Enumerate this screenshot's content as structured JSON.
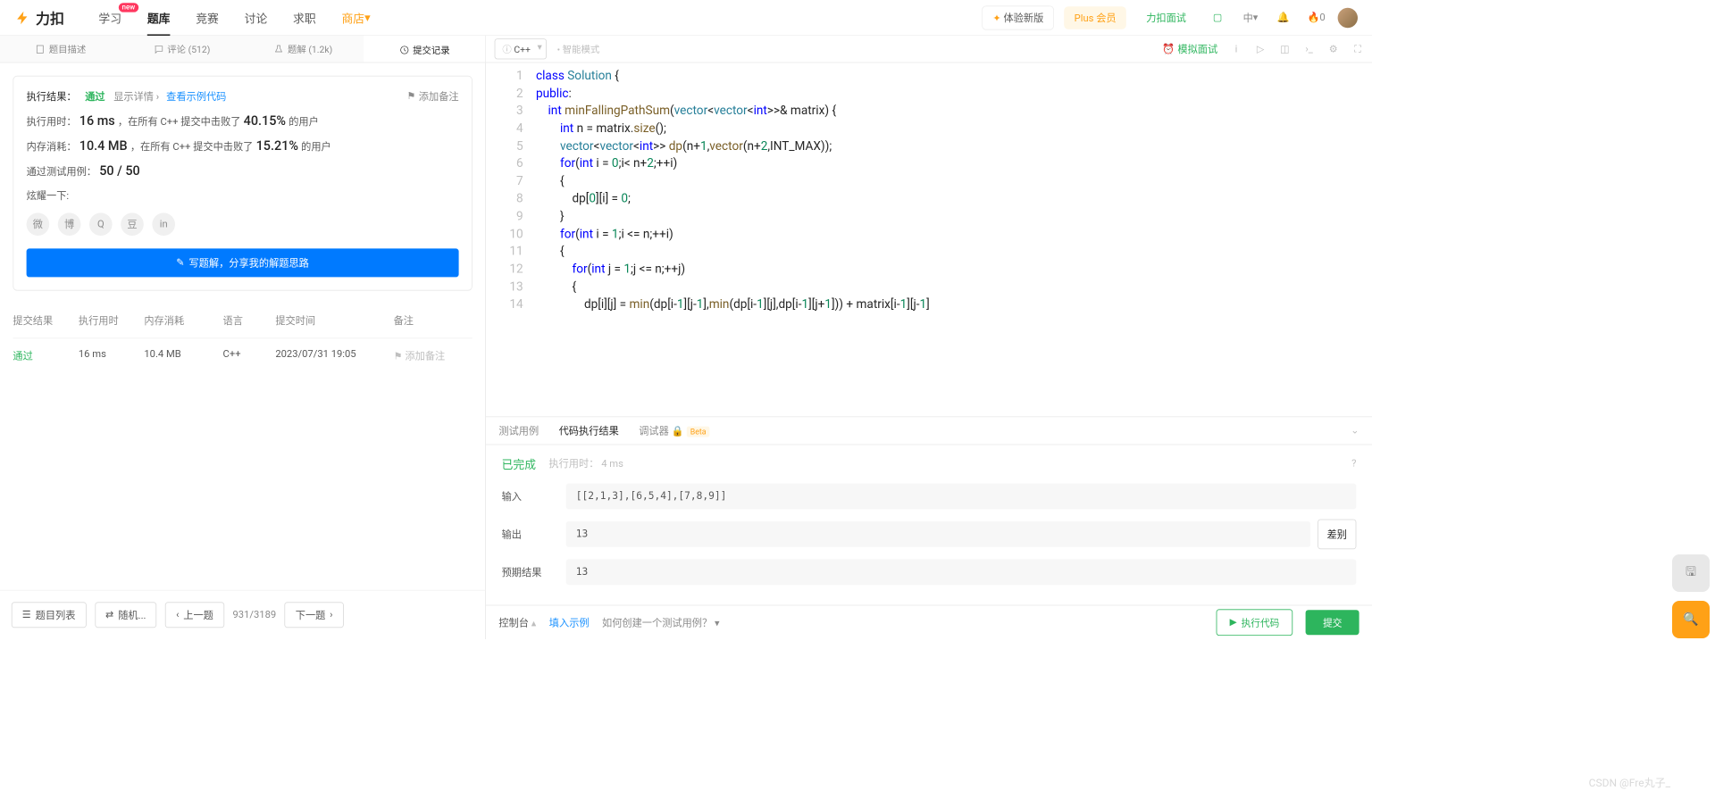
{
  "brand": "力扣",
  "nav": {
    "learn": "学习",
    "problems": "题库",
    "contest": "竞赛",
    "discuss": "讨论",
    "career": "求职",
    "store": "商店",
    "new_badge": "new"
  },
  "header": {
    "try_new": "体验新版",
    "plus": "Plus 会员",
    "interview": "力扣面试",
    "lang_short": "中",
    "fire_count": "0"
  },
  "left_tabs": {
    "desc": "题目描述",
    "comments": "评论 (512)",
    "solutions": "题解 (1.2k)",
    "submissions": "提交记录"
  },
  "result": {
    "exec_label": "执行结果：",
    "pass": "通过",
    "show_detail": "显示详情 ›",
    "view_example": "查看示例代码",
    "add_note": "添加备注",
    "time_label": "执行用时：",
    "time_val": "16 ms",
    "time_mid": "，在所有 C++ 提交中击败了",
    "time_pct": "40.15%",
    "time_suffix": " 的用户",
    "mem_label": "内存消耗：",
    "mem_val": "10.4 MB",
    "mem_mid": "，在所有 C++ 提交中击败了",
    "mem_pct": "15.21%",
    "mem_suffix": " 的用户",
    "tests_label": "通过测试用例：",
    "tests_val": "50 / 50",
    "flex_label": "炫耀一下:",
    "write_btn": "写题解，分享我的解题思路"
  },
  "sub_table": {
    "h1": "提交结果",
    "h2": "执行用时",
    "h3": "内存消耗",
    "h4": "语言",
    "h5": "提交时间",
    "h6": "备注",
    "r1": "通过",
    "r2": "16 ms",
    "r3": "10.4 MB",
    "r4": "C++",
    "r5": "2023/07/31 19:05",
    "r6": "添加备注"
  },
  "left_footer": {
    "list": "题目列表",
    "random": "随机...",
    "prev": "上一题",
    "next": "下一题",
    "page": "931/3189"
  },
  "editor_bar": {
    "lang": "C++",
    "mode": "智能模式",
    "mock": "模拟面试"
  },
  "code": {
    "l1_a": "class",
    "l1_b": "Solution",
    "l1_c": " {",
    "l2": "public",
    "l3_a": "int",
    "l3_b": "minFallingPathSum",
    "l3_c": "vector",
    "l3_d": "vector",
    "l3_e": "int",
    "l3_f": "matrix",
    "l4_a": "int",
    "l4_b": " n = matrix.",
    "l4_c": "size",
    "l4_d": "();",
    "l5_a": "vector",
    "l5_b": "vector",
    "l5_c": "int",
    "l5_d": "dp",
    "l5_e": "(n+",
    "l5_f": "1",
    "l5_g": ",",
    "l5_h": "vector",
    "l5_i": "(n+",
    "l5_j": "2",
    "l5_k": ",INT_MAX));",
    "l6_a": "for",
    "l6_b": "int",
    "l6_c": " i = ",
    "l6_d": "0",
    "l6_e": ";i< n+",
    "l6_f": "2",
    "l6_g": ";++i)",
    "l7": "{",
    "l8_a": "dp[",
    "l8_b": "0",
    "l8_c": "][i] = ",
    "l8_d": "0",
    "l8_e": ";",
    "l9": "}",
    "l10_a": "for",
    "l10_b": "int",
    "l10_c": " i = ",
    "l10_d": "1",
    "l10_e": ";i <= n;++i)",
    "l11": "{",
    "l12_a": "for",
    "l12_b": "int",
    "l12_c": " j = ",
    "l12_d": "1",
    "l12_e": ";j <= n;++j)",
    "l13": "{",
    "l14_a": "dp[i][j] = ",
    "l14_b": "min",
    "l14_c": "(dp[i-",
    "l14_d": "1",
    "l14_e": "][j-",
    "l14_f": "1",
    "l14_g": "],",
    "l14_h": "min",
    "l14_i": "(dp[i-",
    "l14_j": "1",
    "l14_k": "][j],dp[i-",
    "l14_l": "1",
    "l14_m": "][j+",
    "l14_n": "1",
    "l14_o": "])) + matrix[i-",
    "l14_p": "1",
    "l14_q": "][j-",
    "l14_r": "1",
    "l14_s": "]"
  },
  "gutter": {
    "1": "1",
    "2": "2",
    "3": "3",
    "4": "4",
    "5": "5",
    "6": "6",
    "7": "7",
    "8": "8",
    "9": "9",
    "10": "10",
    "11": "11",
    "12": "12",
    "13": "13",
    "14": "14"
  },
  "btabs": {
    "test": "测试用例",
    "exec": "代码执行结果",
    "debug": "调试器",
    "beta": "Beta"
  },
  "exec": {
    "done": "已完成",
    "time_lbl": "执行用时：",
    "time_val": "4 ms",
    "input_lbl": "输入",
    "input_val": "[[2,1,3],[6,5,4],[7,8,9]]",
    "output_lbl": "输出",
    "output_val": "13",
    "expect_lbl": "预期结果",
    "expect_val": "13",
    "diff": "差别"
  },
  "right_footer": {
    "console": "控制台",
    "fill": "填入示例",
    "howto": "如何创建一个测试用例？",
    "run": "执行代码",
    "submit": "提交"
  },
  "watermark": "CSDN @Fre丸子_"
}
